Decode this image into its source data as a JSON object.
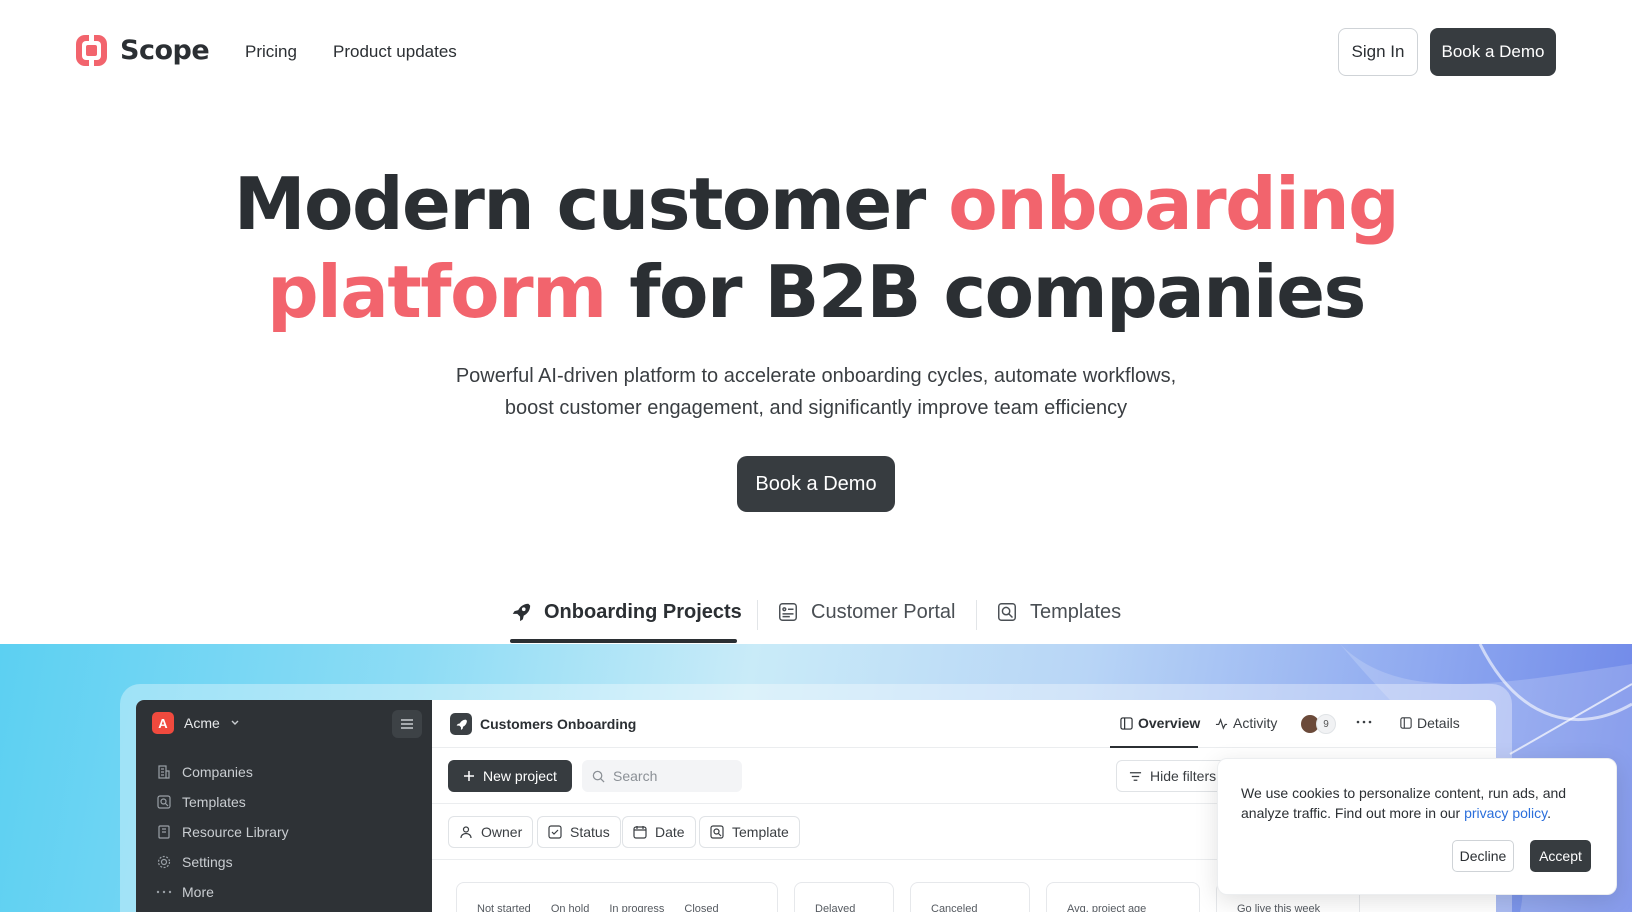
{
  "nav": {
    "brand": "Scope",
    "links": [
      "Pricing",
      "Product updates"
    ],
    "sign_in": "Sign In",
    "book_demo": "Book a Demo"
  },
  "hero": {
    "title_part1": "Modern customer ",
    "title_accent1": "onboarding",
    "title_accent2": "platform",
    "title_part2": " for B2B companies",
    "subtitle_line1": "Powerful AI-driven platform to accelerate onboarding cycles, automate workflows,",
    "subtitle_line2": "boost customer engagement, and significantly improve team efficiency",
    "cta": "Book a Demo"
  },
  "tabs": [
    {
      "label": "Onboarding Projects",
      "icon": "rocket-icon",
      "active": true
    },
    {
      "label": "Customer Portal",
      "icon": "portal-icon",
      "active": false
    },
    {
      "label": "Templates",
      "icon": "templates-icon",
      "active": false
    }
  ],
  "app": {
    "workspace": {
      "badge": "A",
      "name": "Acme"
    },
    "sidebar": [
      "Companies",
      "Templates",
      "Resource Library",
      "Settings",
      "More"
    ],
    "page_title": "Customers Onboarding",
    "top_tabs": [
      "Overview",
      "Activity"
    ],
    "member_count": "9",
    "details": "Details",
    "new_project": "New project",
    "search_placeholder": "Search",
    "hide_filters": "Hide filters",
    "filters": [
      "Owner",
      "Status",
      "Date",
      "Template"
    ],
    "stat_cards": [
      [
        "Not started",
        "On hold",
        "In progress",
        "Closed"
      ],
      [
        "Delayed"
      ],
      [
        "Canceled"
      ],
      [
        "Avg. project age"
      ],
      [
        "Go live this week"
      ]
    ]
  },
  "cookie": {
    "text": "We use cookies to personalize content, run ads, and analyze traffic. Find out more in our ",
    "link": "privacy policy",
    "text_end": ".",
    "decline": "Decline",
    "accept": "Accept"
  },
  "colors": {
    "accent": "#f2646d",
    "dark": "#373c40"
  }
}
